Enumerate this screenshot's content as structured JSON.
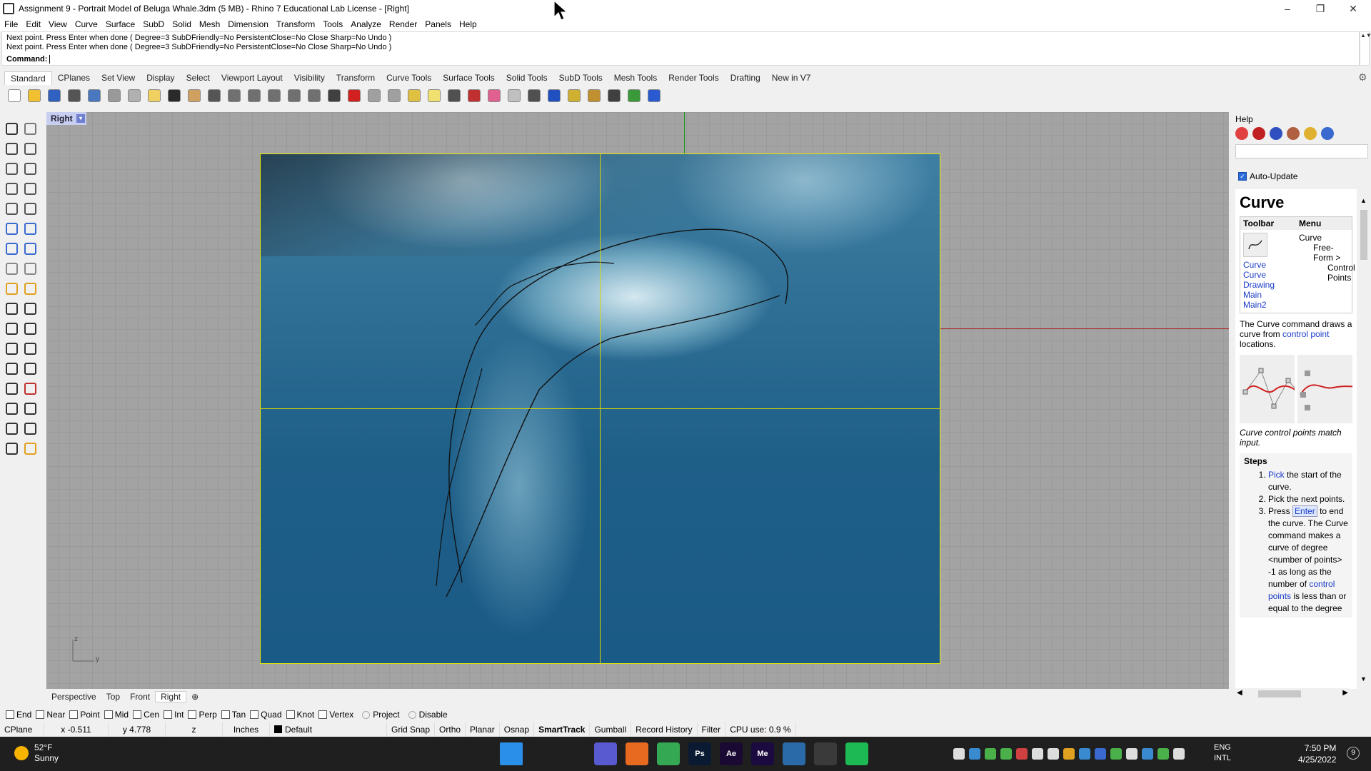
{
  "window": {
    "title": "Assignment 9 - Portrait Model of Beluga Whale.3dm (5 MB) - Rhino 7 Educational Lab License - [Right]",
    "minimize": "–",
    "maximize": "❐",
    "close": "✕"
  },
  "menu": [
    "File",
    "Edit",
    "View",
    "Curve",
    "Surface",
    "SubD",
    "Solid",
    "Mesh",
    "Dimension",
    "Transform",
    "Tools",
    "Analyze",
    "Render",
    "Panels",
    "Help"
  ],
  "command": {
    "history1": "Next point. Press Enter when done ( Degree=3  SubDFriendly=No  PersistentClose=No  Close  Sharp=No  Undo )",
    "history2": "Next point. Press Enter when done ( Degree=3  SubDFriendly=No  PersistentClose=No  Close  Sharp=No  Undo )",
    "prompt": "Command:",
    "value": "",
    "scroll": "▲▼"
  },
  "toolbar_tabs": [
    "Standard",
    "CPlanes",
    "Set View",
    "Display",
    "Select",
    "Viewport Layout",
    "Visibility",
    "Transform",
    "Curve Tools",
    "Surface Tools",
    "Solid Tools",
    "SubD Tools",
    "Mesh Tools",
    "Render Tools",
    "Drafting",
    "New in V7"
  ],
  "toolbar_icons": [
    "new",
    "open",
    "save",
    "print",
    "export",
    "cut",
    "copy",
    "paste",
    "undo",
    "pan",
    "rotate",
    "zoom-window",
    "zoom-dynamic",
    "zoom-extents",
    "zoom-selected",
    "rotate-view",
    "four-views",
    "car",
    "plane",
    "circle",
    "lights",
    "bulb",
    "lock",
    "shield",
    "color-wheel",
    "sphere-grey",
    "sphere-dark",
    "sphere-blue",
    "wand",
    "gear",
    "grid-snap",
    "globe",
    "help"
  ],
  "toolbar_colors": [
    "#ffffff",
    "#f0c030",
    "#3060c0",
    "#555555",
    "#4a78c0",
    "#999999",
    "#b0b0b0",
    "#f0d060",
    "#2a2a2a",
    "#d0a060",
    "#555555",
    "#707070",
    "#707070",
    "#707070",
    "#707070",
    "#707070",
    "#404040",
    "#d02020",
    "#a0a0a0",
    "#a0a0a0",
    "#e0c040",
    "#f0e070",
    "#505050",
    "#c03030",
    "#e06090",
    "#c0c0c0",
    "#505050",
    "#2050c0",
    "#d0b030",
    "#c09030",
    "#404040",
    "#3a9a3a",
    "#2a5ad0"
  ],
  "left_tools": [
    "select",
    "point",
    "polyline",
    "curve",
    "circle",
    "arc",
    "rectangle",
    "polygon",
    "ellipse",
    "fillet",
    "surface",
    "patch",
    "box",
    "boolean",
    "extrude",
    "pipe",
    "explode",
    "trim",
    "move",
    "scale",
    "cone",
    "array",
    "rotate",
    "mirror",
    "text",
    "dimension",
    "layers",
    "properties",
    "mesh",
    "check",
    "lattice",
    "analyze",
    "shade",
    "render"
  ],
  "left_tool_colors": [
    "#333",
    "#777",
    "#444",
    "#555",
    "#555",
    "#555",
    "#555",
    "#555",
    "#555",
    "#555",
    "#3a6ad0",
    "#3a6ad0",
    "#3a6ad0",
    "#3a6ad0",
    "#888",
    "#888",
    "#e0a020",
    "#e0a020",
    "#333",
    "#333",
    "#333",
    "#333",
    "#333",
    "#333",
    "#333",
    "#333",
    "#333",
    "#c03030",
    "#333",
    "#333",
    "#333",
    "#333",
    "#333",
    "#e0a020"
  ],
  "viewport": {
    "name": "Right",
    "dropdown": "▾",
    "axis_z": "z",
    "axis_y": "y"
  },
  "viewport_tabs": [
    "Perspective",
    "Top",
    "Front",
    "Right"
  ],
  "viewport_add": "⊕",
  "osnaps": [
    {
      "label": "End",
      "checked": false
    },
    {
      "label": "Near",
      "checked": false
    },
    {
      "label": "Point",
      "checked": false
    },
    {
      "label": "Mid",
      "checked": false
    },
    {
      "label": "Cen",
      "checked": false
    },
    {
      "label": "Int",
      "checked": false
    },
    {
      "label": "Perp",
      "checked": false
    },
    {
      "label": "Tan",
      "checked": false
    },
    {
      "label": "Quad",
      "checked": false
    },
    {
      "label": "Knot",
      "checked": false
    },
    {
      "label": "Vertex",
      "checked": false
    }
  ],
  "osnap_extra": [
    "Project",
    "Disable"
  ],
  "status": {
    "cplane": "CPlane",
    "x": "x -0.511",
    "y": "y 4.778",
    "z": "z",
    "units": "Inches",
    "layer": "Default",
    "grid_snap": "Grid Snap",
    "ortho": "Ortho",
    "planar": "Planar",
    "osnap": "Osnap",
    "smarttrack": "SmartTrack",
    "gumball": "Gumball",
    "record_history": "Record History",
    "filter": "Filter",
    "cpu": "CPU use: 0.9 %"
  },
  "help_panel": {
    "title": "Help",
    "auto_update": "Auto-Update",
    "heading": "Curve",
    "col_toolbar": "Toolbar",
    "col_menu": "Menu",
    "toolbar_links": [
      "Curve",
      "Curve Drawing",
      "Main",
      "Main2"
    ],
    "menu_path1": "Curve",
    "menu_path2": "Free-Form >",
    "menu_path3": "Control Points",
    "desc_pre": "The Curve command draws a curve from",
    "desc_link": "control point",
    "desc_post": "locations.",
    "caption": "Curve control points match input.",
    "steps_title": "Steps",
    "step1_link": "Pick",
    "step1": "the start of the curve.",
    "step2": "Pick the next points.",
    "step3_pre": "Press",
    "step3_key": "Enter",
    "step3_post": "to end the curve. The Curve command makes a curve of degree <number of points> -1 as long as the number of",
    "step3_link": "control points",
    "step3_end": "is less than or equal to the degree",
    "scroll_left": "◀",
    "scroll_right": "▶",
    "scroll_up": "▲",
    "scroll_down": "▼",
    "panel_icons": [
      "#e04040",
      "#c02020",
      "#3050c0",
      "#b06040",
      "#e0b030",
      "#3a6ad0"
    ]
  },
  "taskbar": {
    "weather_temp": "52°F",
    "weather_desc": "Sunny",
    "apps": [
      {
        "name": "start",
        "label": "",
        "color": "#2a8fe8"
      },
      {
        "name": "search",
        "label": "",
        "color": "#1f1f1f"
      },
      {
        "name": "taskview",
        "label": "",
        "color": "#1f1f1f"
      },
      {
        "name": "teams",
        "label": "",
        "color": "#5a5ad0"
      },
      {
        "name": "firefox",
        "label": "",
        "color": "#e86a20"
      },
      {
        "name": "chrome",
        "label": "",
        "color": "#34a853"
      },
      {
        "name": "photoshop",
        "label": "Ps",
        "color": "#0a1a33"
      },
      {
        "name": "aftereffects",
        "label": "Ae",
        "color": "#1a0a33"
      },
      {
        "name": "mediaencoder",
        "label": "Me",
        "color": "#1a0a40"
      },
      {
        "name": "taskmanager",
        "label": "",
        "color": "#2a6aa8"
      },
      {
        "name": "rhino",
        "label": "",
        "color": "#3a3a3a"
      },
      {
        "name": "spotify",
        "label": "",
        "color": "#1db954"
      }
    ],
    "tray_colors": [
      "#dddddd",
      "#3a8ad0",
      "#4ab04a",
      "#4ab04a",
      "#d04040",
      "#dddddd",
      "#dddddd",
      "#e0a020",
      "#3a8ad0",
      "#3a6ad0",
      "#4ab04a",
      "#dddddd",
      "#3a8ad0",
      "#4ab04a",
      "#dddddd"
    ],
    "lang1": "ENG",
    "lang2": "INTL",
    "time": "7:50 PM",
    "date": "4/25/2022",
    "notifications": "9"
  }
}
